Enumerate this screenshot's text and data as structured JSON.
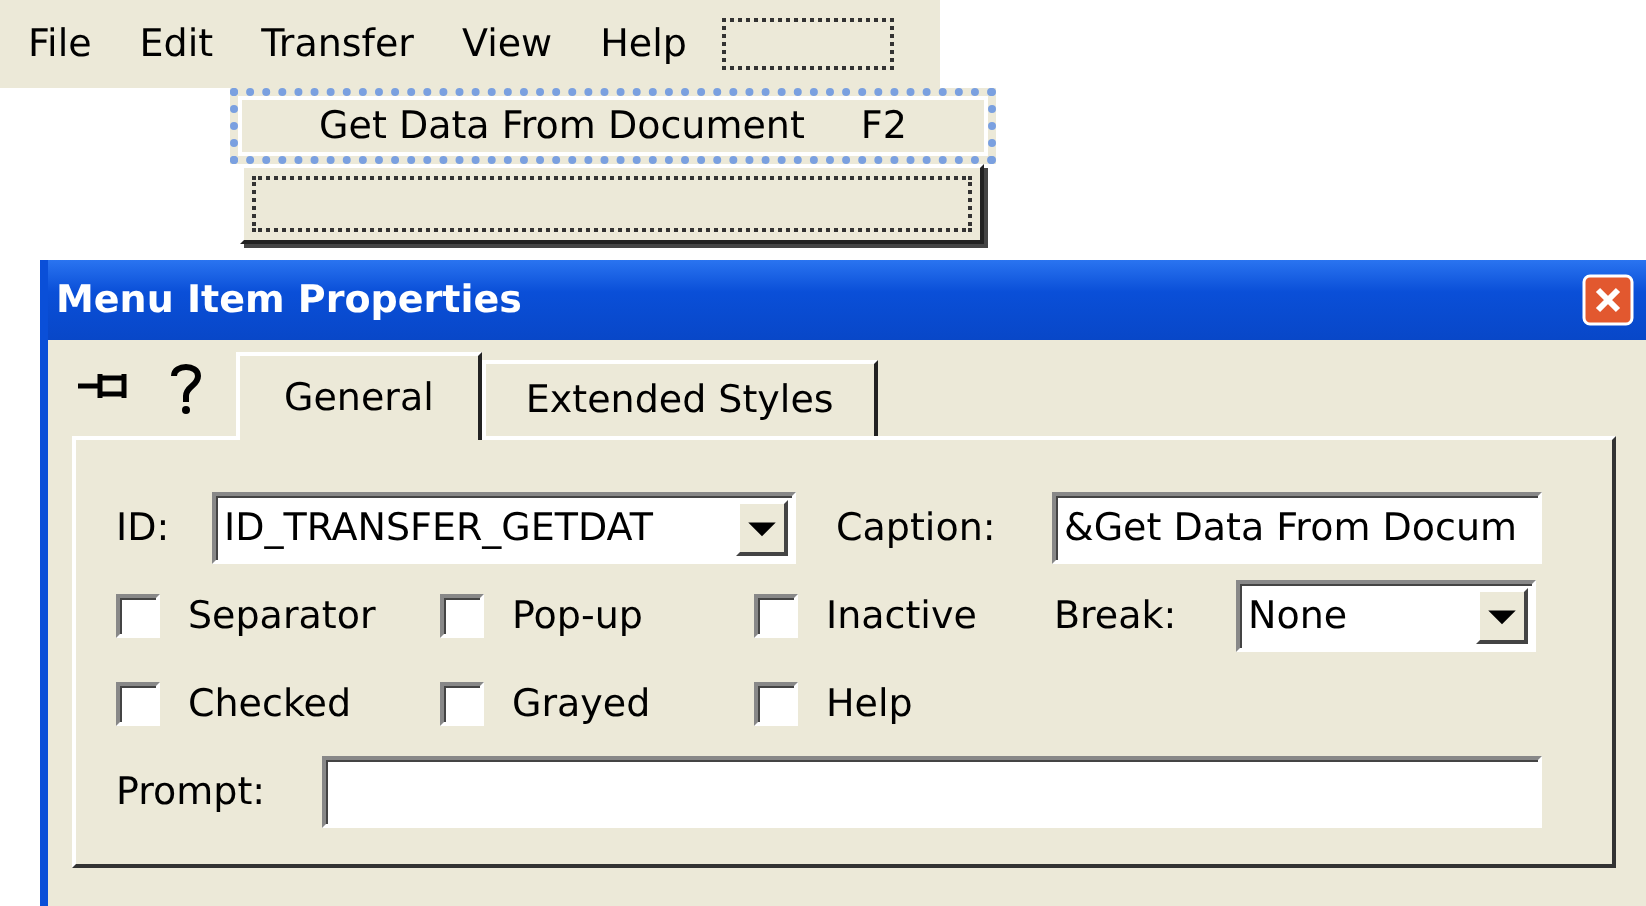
{
  "menubar": {
    "items": [
      {
        "label": "File"
      },
      {
        "label": "Edit"
      },
      {
        "label": "Transfer"
      },
      {
        "label": "View"
      },
      {
        "label": "Help"
      }
    ]
  },
  "menu": {
    "items": [
      {
        "label": "Get Data From Document",
        "shortcut": "F2",
        "selected": true
      }
    ]
  },
  "dialog": {
    "title": "Menu Item Properties",
    "tabs": [
      {
        "label": "General",
        "selected": true
      },
      {
        "label": "Extended Styles",
        "selected": false
      }
    ],
    "id_field": {
      "label": "ID:",
      "value": "ID_TRANSFER_GETDAT"
    },
    "caption_field": {
      "label": "Caption:",
      "value": "&Get Data From Docum"
    },
    "checkboxes": [
      {
        "label": "Separator",
        "checked": false
      },
      {
        "label": "Pop-up",
        "checked": false
      },
      {
        "label": "Inactive",
        "checked": false
      },
      {
        "label": "Checked",
        "checked": false
      },
      {
        "label": "Grayed",
        "checked": false
      },
      {
        "label": "Help",
        "checked": false
      }
    ],
    "break_field": {
      "label": "Break:",
      "value": "None"
    },
    "prompt_field": {
      "label": "Prompt:"
    }
  }
}
